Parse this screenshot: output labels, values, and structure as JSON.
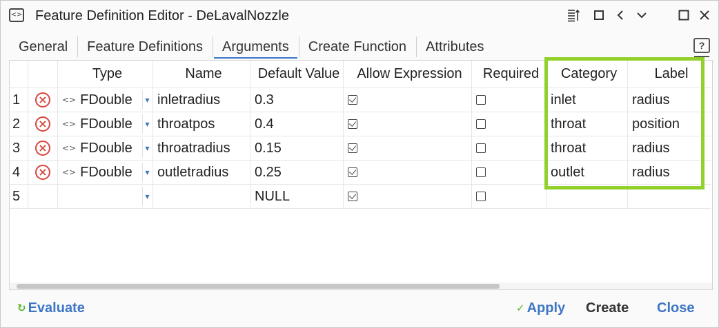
{
  "window": {
    "title": "Feature Definition Editor - DeLavalNozzle"
  },
  "icons": {
    "app": "code-window-icon",
    "list": "list-sort-icon",
    "restore": "square-icon",
    "back": "chevron-left-icon",
    "dropdown": "chevron-down-icon",
    "maximize": "maximize-icon",
    "close": "close-icon",
    "help": "help-icon"
  },
  "tabs": [
    {
      "label": "General",
      "active": false
    },
    {
      "label": "Feature Definitions",
      "active": false
    },
    {
      "label": "Arguments",
      "active": true
    },
    {
      "label": "Create Function",
      "active": false
    },
    {
      "label": "Attributes",
      "active": false
    }
  ],
  "columns": [
    "Type",
    "Name",
    "Default Value",
    "Allow Expression",
    "Required",
    "Category",
    "Label"
  ],
  "rows": [
    {
      "num": "1",
      "type": "FDouble",
      "name": "inletradius",
      "default": "0.3",
      "allow_expression": true,
      "required": false,
      "category": "inlet",
      "label": "radius"
    },
    {
      "num": "2",
      "type": "FDouble",
      "name": "throatpos",
      "default": "0.4",
      "allow_expression": true,
      "required": false,
      "category": "throat",
      "label": "position"
    },
    {
      "num": "3",
      "type": "FDouble",
      "name": "throatradius",
      "default": "0.15",
      "allow_expression": true,
      "required": false,
      "category": "throat",
      "label": "radius"
    },
    {
      "num": "4",
      "type": "FDouble",
      "name": "outletradius",
      "default": "0.25",
      "allow_expression": true,
      "required": false,
      "category": "outlet",
      "label": "radius"
    },
    {
      "num": "5",
      "type": "",
      "name": "",
      "default": "NULL",
      "allow_expression": true,
      "required": false,
      "category": "",
      "label": ""
    }
  ],
  "footer": {
    "evaluate": "Evaluate",
    "apply": "Apply",
    "create": "Create",
    "close": "Close"
  },
  "colors": {
    "accent": "#3d76c5",
    "highlight": "#92d12b",
    "delete": "#d9443a"
  }
}
